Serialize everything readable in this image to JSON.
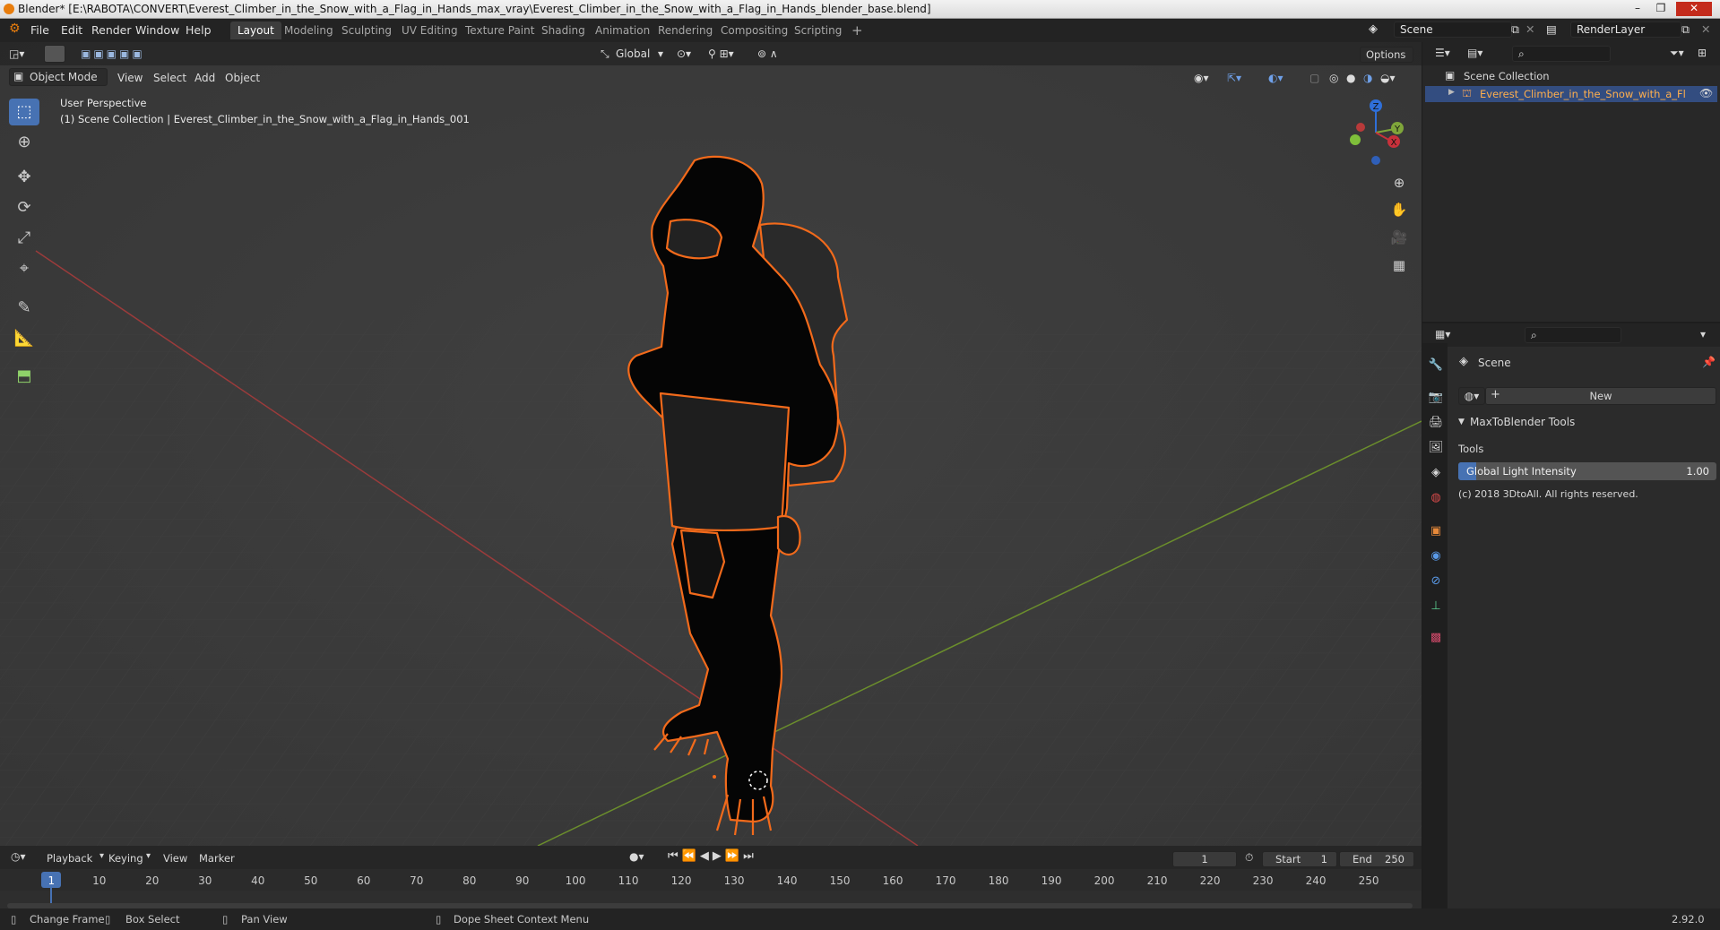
{
  "window": {
    "title": "Blender* [E:\\RABOTA\\CONVERT\\Everest_Climber_in_the_Snow_with_a_Flag_in_Hands_max_vray\\Everest_Climber_in_the_Snow_with_a_Flag_in_Hands_blender_base.blend]"
  },
  "menu": [
    "File",
    "Edit",
    "Render",
    "Window",
    "Help"
  ],
  "workspaces": [
    "Layout",
    "Modeling",
    "Sculpting",
    "UV Editing",
    "Texture Paint",
    "Shading",
    "Animation",
    "Rendering",
    "Compositing",
    "Scripting"
  ],
  "workspace_add": "+",
  "scene_field": "Scene",
  "renderlayer_field": "RenderLayer",
  "viewport": {
    "orientation": "Global",
    "options_label": "Options",
    "mode": "Object Mode",
    "menus": [
      "View",
      "Select",
      "Add",
      "Object"
    ],
    "overlay_title": "User Perspective",
    "overlay_subtitle": "(1) Scene Collection | Everest_Climber_in_the_Snow_with_a_Flag_in_Hands_001",
    "gizmo": {
      "z": "Z",
      "y": "Y",
      "x": "X"
    }
  },
  "outliner": {
    "root": "Scene Collection",
    "item": "Everest_Climber_in_the_Snow_with_a_Flag_i"
  },
  "properties": {
    "context": "Scene",
    "new_button": "New",
    "panel_title": "MaxToBlender Tools",
    "tools_label": "Tools",
    "slider_label": "Global Light Intensity",
    "slider_value": "1.00",
    "slider_fill": 0.07,
    "copyright": "(c) 2018 3DtoAll. All rights reserved."
  },
  "timeline": {
    "menus": [
      "Playback",
      "Keying",
      "View",
      "Marker"
    ],
    "current_frame": "1",
    "start_label": "Start",
    "start_value": "1",
    "end_label": "End",
    "end_value": "250",
    "ruler": [
      "1",
      "10",
      "20",
      "30",
      "40",
      "50",
      "60",
      "70",
      "80",
      "90",
      "100",
      "110",
      "120",
      "130",
      "140",
      "150",
      "160",
      "170",
      "180",
      "190",
      "200",
      "210",
      "220",
      "230",
      "240",
      "250"
    ]
  },
  "statusbar": {
    "items": [
      "Change Frame",
      "Box Select",
      "Pan View",
      "Dope Sheet Context Menu"
    ],
    "version": "2.92.0"
  },
  "colors": {
    "accent": "#4772b3",
    "selection_outline": "#f26a1b",
    "x_axis": "#9b3b3b",
    "y_axis": "#6b8e2c"
  }
}
